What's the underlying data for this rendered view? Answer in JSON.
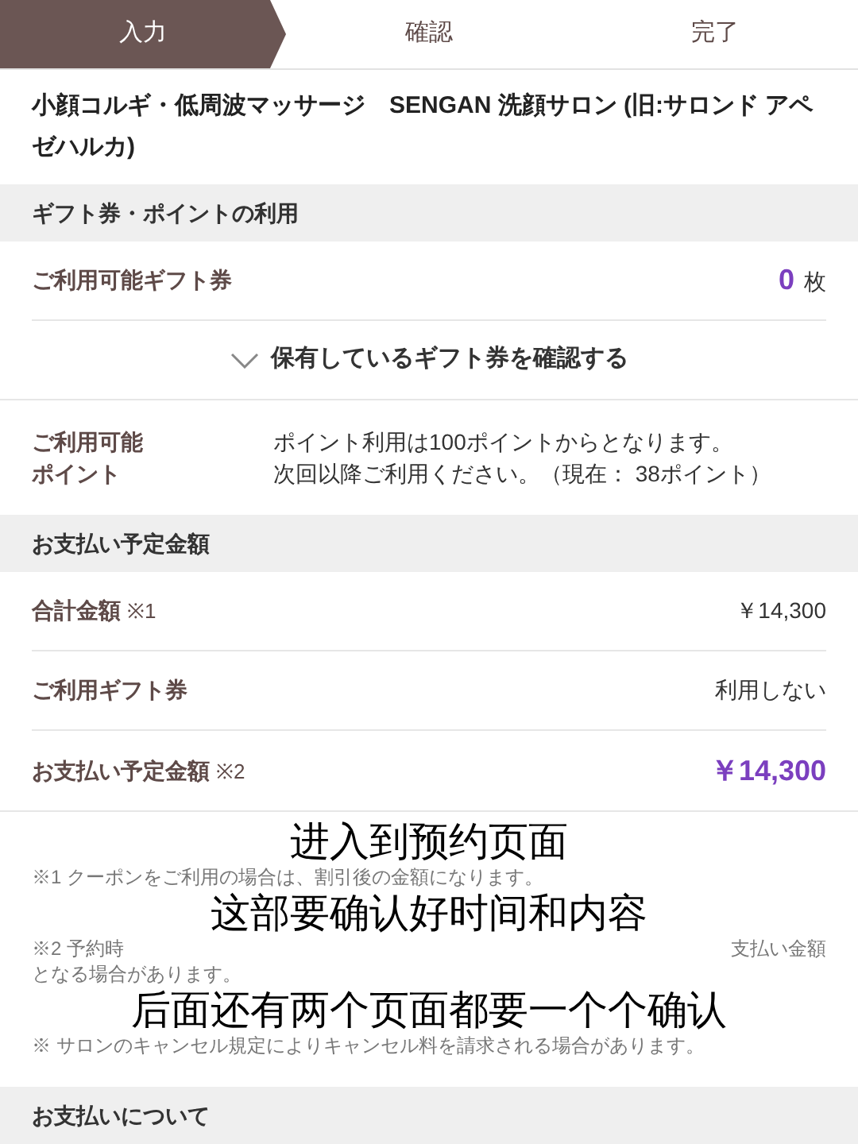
{
  "steps": [
    {
      "label": "入力",
      "selected": true
    },
    {
      "label": "確認",
      "selected": false
    },
    {
      "label": "完了",
      "selected": false
    }
  ],
  "salon_name": "小顔コルギ・低周波マッサージ　SENGAN 洗顔サロン (旧:サロンド アペゼハルカ)",
  "gift_section": {
    "header": "ギフト券・ポイントの利用",
    "gift_label": "ご利用可能ギフト券",
    "gift_count": "0",
    "gift_unit": "枚",
    "toggle_link": "保有しているギフト券を確認する",
    "points_label": "ご利用可能ポイント",
    "points_message": [
      "ポイント利用は100ポイントからとなります。",
      "次回以降ご利用ください。（現在： 38ポイント）"
    ]
  },
  "payment_section": {
    "header": "お支払い予定金額",
    "rows": [
      {
        "kind": "plain",
        "label": "合計金額",
        "note": "※1",
        "value": "￥14,300"
      },
      {
        "kind": "plain",
        "label": "ご利用ギフト券",
        "value": "利用しない"
      },
      {
        "kind": "total",
        "label": "お支払い予定金額",
        "note": "※2",
        "value": "￥14,300"
      }
    ]
  },
  "notes": [
    {
      "kind": "caption",
      "text": "进入到预约页面"
    },
    {
      "kind": "footnote",
      "text": "※1 クーポンをご利用の場合は、割引後の金額になります。"
    },
    {
      "kind": "caption",
      "text": "这部要确认好时间和内容"
    },
    {
      "kind": "footnote",
      "parts": [
        "※2 予約時",
        "支払い金額"
      ]
    },
    {
      "kind": "footnote",
      "text": "となる場合があります。"
    },
    {
      "kind": "caption",
      "text": "后面还有两个页面都要一个个确认"
    },
    {
      "kind": "footnote",
      "text": "※ サロンのキャンセル規定によりキャンセル料を請求される場合があります。"
    }
  ],
  "payment_info_header": "お支払いについて"
}
